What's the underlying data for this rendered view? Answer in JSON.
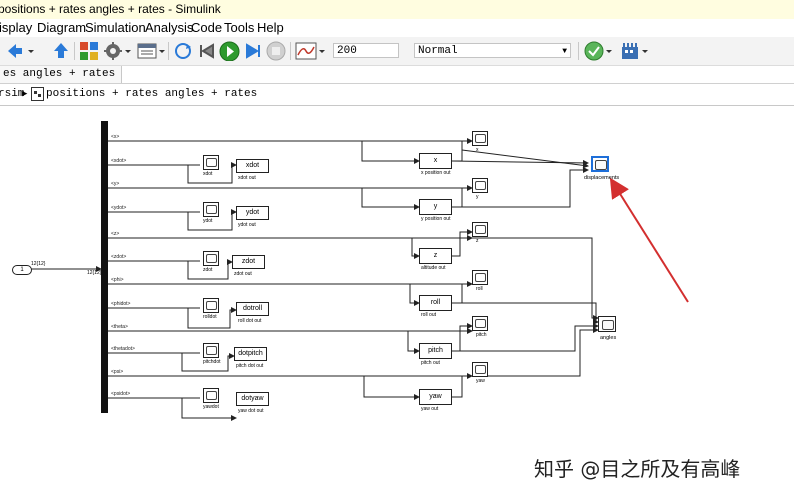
{
  "window": {
    "title": "positions + rates angles + rates - Simulink"
  },
  "menu": [
    "isplay",
    "Diagram",
    "Simulation",
    "Analysis",
    "Code",
    "Tools",
    "Help"
  ],
  "toolbar": {
    "stop_time": "200",
    "sim_mode": "Normal",
    "icons": [
      "back-icon",
      "forward-icon",
      "up-icon",
      "library-browser-icon",
      "model-config-icon",
      "model-explorer-icon",
      "refresh-icon",
      "step-back-icon",
      "run-icon",
      "step-forward-icon",
      "stop-icon",
      "scope-icon",
      "check-icon",
      "build-icon"
    ]
  },
  "tab": {
    "label": "es angles + rates"
  },
  "breadcrumb": {
    "root": "rsim",
    "current": "positions + rates angles + rates"
  },
  "diagram": {
    "inport": {
      "number": "1",
      "dim": "12{12}"
    },
    "demux_dim": "12{12}",
    "signals": [
      "<x>",
      "<xdot>",
      "<y>",
      "<ydot>",
      "<z>",
      "<zdot>",
      "<phi>",
      "<phidot>",
      "<theta>",
      "<thetadot>",
      "<psi>",
      "<psidot>"
    ],
    "rate_blocks": [
      {
        "scope": "xdot",
        "out": "xdot",
        "caption": "xdot out"
      },
      {
        "scope": "ydot",
        "out": "ydot",
        "caption": "ydot out"
      },
      {
        "scope": "zdot",
        "out": "zdot",
        "caption": "zdot out"
      },
      {
        "scope": "rolldot",
        "out": "dotroll",
        "caption": "roll dot out"
      },
      {
        "scope": "pitchdot",
        "out": "dotpitch",
        "caption": "pitch dot out"
      },
      {
        "scope": "yawdot",
        "out": "dotyaw",
        "caption": "yaw dot out"
      }
    ],
    "position_blocks": [
      {
        "out": "x",
        "caption": "x position out",
        "scope": "x"
      },
      {
        "out": "y",
        "caption": "y position out",
        "scope": "y"
      },
      {
        "out": "z",
        "caption": "altitude out",
        "scope": "z"
      },
      {
        "out": "roll",
        "caption": "roll out",
        "scope": "roll"
      },
      {
        "out": "pitch",
        "caption": "pitch out",
        "scope": "pitch"
      },
      {
        "out": "yaw",
        "caption": "yaw out",
        "scope": "yaw"
      }
    ],
    "mux_scopes": [
      "displacements",
      "angles"
    ]
  },
  "watermark": "知乎 @目之所及有高峰",
  "colors": {
    "annotation_arrow": "#d32f2f",
    "title_bg": "#fffde0",
    "run_green": "#2e9a2e",
    "selected_blue": "#1e6fd9"
  }
}
